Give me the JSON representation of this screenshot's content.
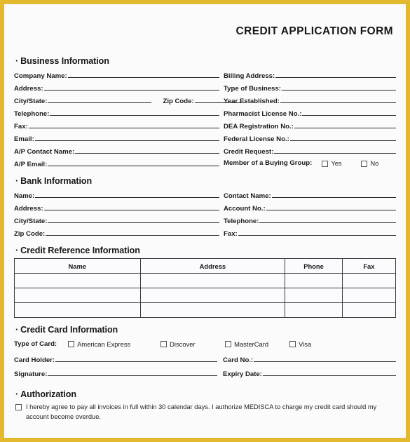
{
  "theme": {
    "border_color": "#e2b92f",
    "page_background": "#fbfbfc",
    "text_color": "#1a1a1a",
    "rule_color": "#2a2a2c"
  },
  "header": {
    "title": "CREDIT APPLICATION FORM"
  },
  "bullet": "·",
  "sections": {
    "business": {
      "heading": "Business Information",
      "left_fields": [
        {
          "label": "Company Name:"
        },
        {
          "label": "Address:"
        },
        {
          "label": "City/State:"
        },
        {
          "label": "Telephone:"
        },
        {
          "label": "Fax:"
        },
        {
          "label": "Email:"
        },
        {
          "label": "A/P Contact Name:"
        },
        {
          "label": "A/P Email:"
        }
      ],
      "zip_label": "Zip Code:",
      "right_fields": [
        {
          "label": "Billing Address:"
        },
        {
          "label": "Type of Business:"
        },
        {
          "label": "Year Established:"
        },
        {
          "label": "Pharmacist License No.:"
        },
        {
          "label": "DEA Registration No.:"
        },
        {
          "label": "Federal License No.:"
        },
        {
          "label": "Credit Request:"
        }
      ],
      "buying_group": {
        "label": "Member of a Buying Group:",
        "options": [
          "Yes",
          "No"
        ]
      }
    },
    "bank": {
      "heading": "Bank Information",
      "left_fields": [
        {
          "label": "Name:"
        },
        {
          "label": "Address:"
        },
        {
          "label": "City/State:"
        },
        {
          "label": "Zip Code:"
        }
      ],
      "right_fields": [
        {
          "label": "Contact Name:"
        },
        {
          "label": "Account No.:"
        },
        {
          "label": "Telephone:"
        },
        {
          "label": "Fax:"
        }
      ]
    },
    "credit_reference": {
      "heading": "Credit Reference Information",
      "columns": [
        "Name",
        "Address",
        "Phone",
        "Fax"
      ],
      "rows": [
        [
          "",
          "",
          "",
          ""
        ],
        [
          "",
          "",
          "",
          ""
        ],
        [
          "",
          "",
          "",
          ""
        ]
      ]
    },
    "credit_card": {
      "heading": "Credit Card Information",
      "type_label": "Type of Card:",
      "card_types": [
        "American Express",
        "Discover",
        "MasterCard",
        "Visa"
      ],
      "left_fields": [
        {
          "label": "Card Holder:"
        },
        {
          "label": "Signature:"
        }
      ],
      "right_fields": [
        {
          "label": "Card No.:"
        },
        {
          "label": "Expiry Date:"
        }
      ]
    },
    "authorization": {
      "heading": "Authorization",
      "statement": "I hereby agree to pay all invoices in full within 30 calendar days. I authorize MEDISCA to charge my credit card should my account become overdue."
    }
  }
}
